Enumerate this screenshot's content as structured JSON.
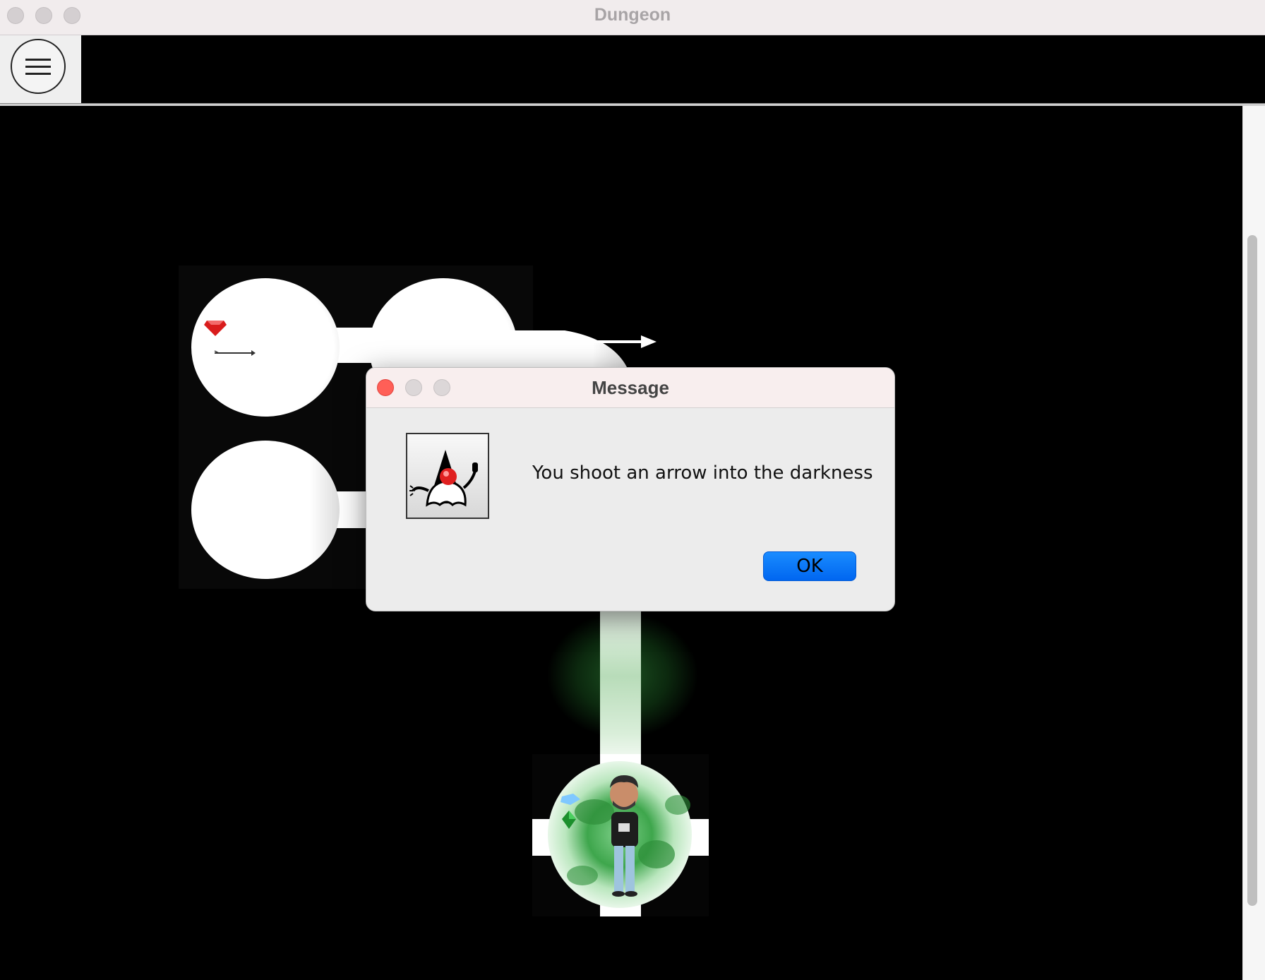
{
  "window": {
    "title": "Dungeon"
  },
  "toolbar": {
    "menu_icon": "hamburger-icon"
  },
  "dialog": {
    "title": "Message",
    "message": "You shoot an arrow into the darkness",
    "icon": "java-duke-icon",
    "ok_label": "OK"
  },
  "colors": {
    "ok_button": "#0a7aff",
    "close_button": "#ff5f57",
    "dialog_titlebar": "#f8eeee",
    "window_titlebar": "#f1eced"
  }
}
